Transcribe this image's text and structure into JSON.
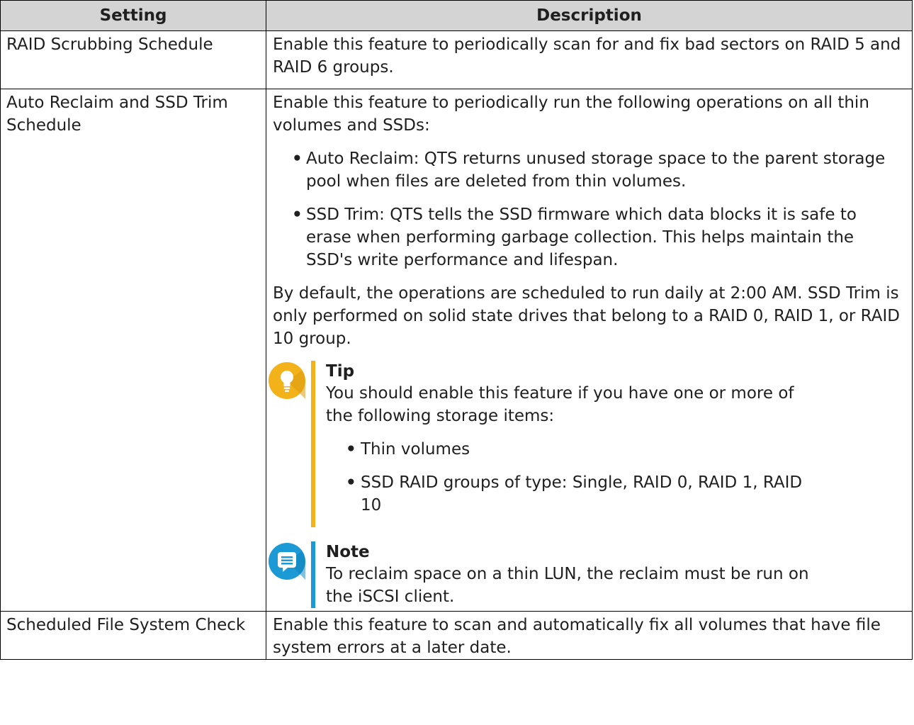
{
  "table": {
    "headers": [
      "Setting",
      "Description"
    ],
    "rows": [
      {
        "setting": "RAID Scrubbing Schedule",
        "description": "Enable this feature to periodically scan for and fix bad sectors on RAID 5 and RAID 6 groups."
      },
      {
        "setting": "Auto Reclaim and SSD Trim Schedule",
        "intro": "Enable this feature to periodically run the following operations on all thin volumes and SSDs:",
        "bullets": [
          "Auto Reclaim: QTS returns unused storage space to the parent storage pool when files are deleted from thin volumes.",
          "SSD Trim: QTS tells the SSD firmware which data blocks it is safe to erase when performing garbage collection. This helps maintain the SSD's write performance and lifespan."
        ],
        "default_text": "By default, the operations are scheduled to run daily at 2:00 AM. SSD Trim is only performed on solid state drives that belong to a RAID 0, RAID 1, or RAID 10 group.",
        "tip": {
          "title": "Tip",
          "text": "You should enable this feature if you have one or more of the following storage items:",
          "items": [
            "Thin volumes",
            "SSD RAID groups of type: Single, RAID 0, RAID 1, RAID 10"
          ],
          "icon": "lightbulb-icon",
          "color": "#f3b21a"
        },
        "note": {
          "title": "Note",
          "text": "To reclaim space on a thin LUN, the reclaim must be run on the iSCSI client.",
          "icon": "speech-bubble-icon",
          "color": "#1b9ad6"
        }
      },
      {
        "setting": "Scheduled File System Check",
        "description": "Enable this feature to scan and automatically fix all volumes that have file system errors at a later date."
      }
    ]
  }
}
